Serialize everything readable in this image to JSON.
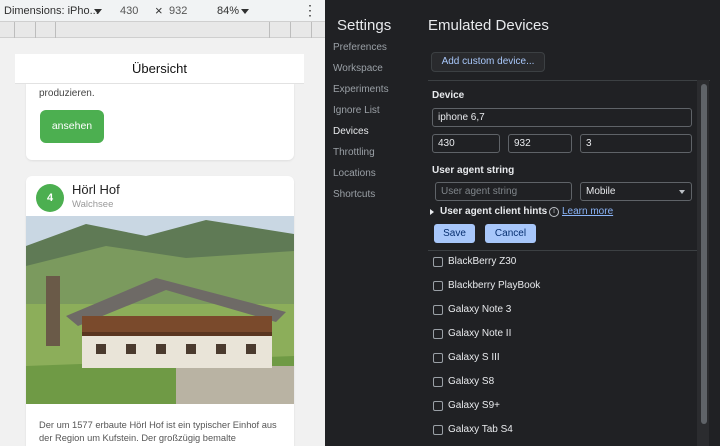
{
  "toolbar": {
    "dimensions_label": "Dimensions: iPho...",
    "width": "430",
    "times": "×",
    "height": "932",
    "zoom": "84%",
    "more": "⋮"
  },
  "phone": {
    "header_title": "Übersicht",
    "card1": {
      "text": "produzieren.",
      "button_label": "ansehen"
    },
    "card2": {
      "number": "4",
      "title": "Hörl Hof",
      "subtitle": "Walchsee",
      "description": "Der um 1577 erbaute Hörl Hof ist ein typischer Einhof aus der Region um Kufstein. Der großzügig bemalte"
    }
  },
  "settings": {
    "title": "Settings",
    "nav": [
      "Preferences",
      "Workspace",
      "Experiments",
      "Ignore List",
      "Devices",
      "Throttling",
      "Locations",
      "Shortcuts"
    ],
    "active_nav": "Devices"
  },
  "emulated": {
    "title": "Emulated Devices",
    "add_custom_label": "Add custom device...",
    "device_label": "Device",
    "device_name": "iphone 6,7",
    "width": "430",
    "height": "932",
    "dpr": "3",
    "ua_label": "User agent string",
    "ua_placeholder": "User agent string",
    "ua_type": "Mobile",
    "hints_label": "User agent client hints",
    "learn_more": "Learn more",
    "save_label": "Save",
    "cancel_label": "Cancel",
    "devices": [
      "BlackBerry Z30",
      "Blackberry PlayBook",
      "Galaxy Note 3",
      "Galaxy Note II",
      "Galaxy S III",
      "Galaxy S8",
      "Galaxy S9+",
      "Galaxy Tab S4"
    ]
  },
  "colors": {
    "accent_green": "#4caf50",
    "devtools_bg": "#202124",
    "link_blue": "#8ab4f8",
    "primary_button": "#a8c7fa"
  }
}
